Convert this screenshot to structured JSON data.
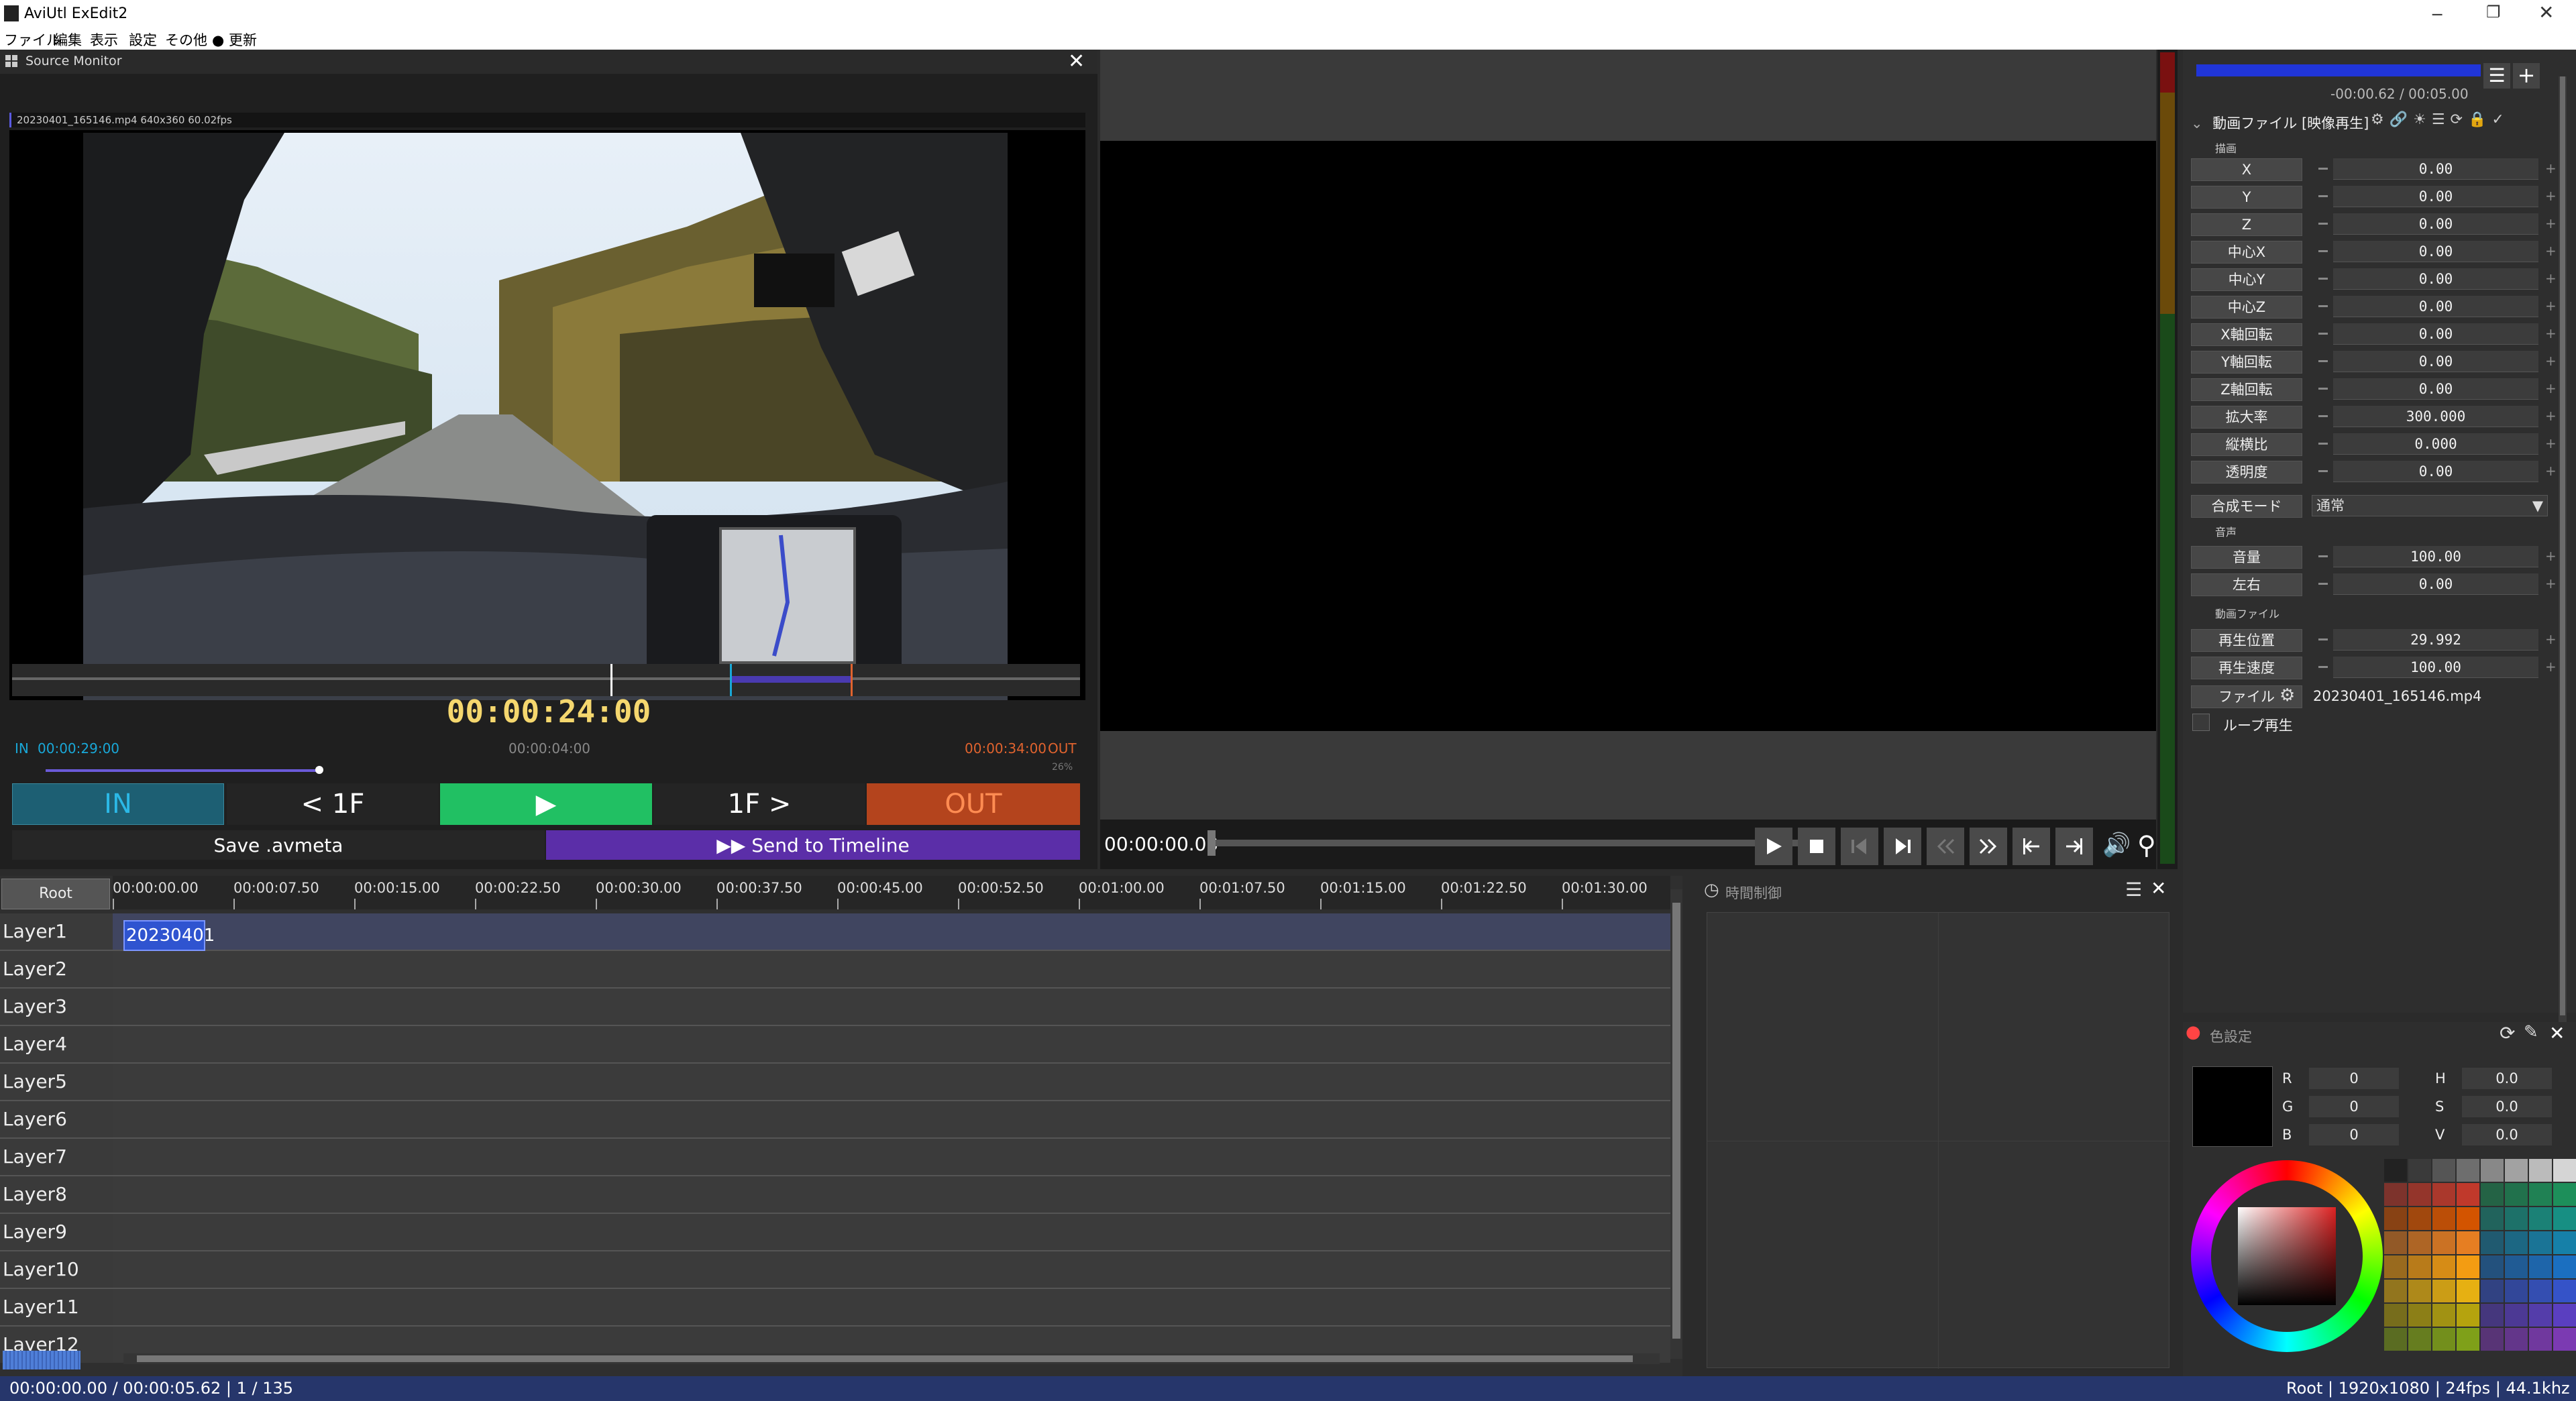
{
  "window": {
    "title": "AviUtl ExEdit2"
  },
  "menu": [
    "ファイル",
    "編集",
    "表示",
    "設定",
    "その他",
    "● 更新"
  ],
  "source_monitor": {
    "title": "Source Monitor",
    "file_info": "20230401_165146.mp4  640x360  60.02fps",
    "timecode": "00:00:24:00",
    "in_label": "IN",
    "in_time": "00:00:29:00",
    "duration": "00:00:04:00",
    "out_time": "00:00:34:00",
    "out_label": "OUT",
    "zoom_percent": "26%",
    "buttons": {
      "in": "IN",
      "prev": "< 1F",
      "play": "▶",
      "next": "1F >",
      "out": "OUT",
      "save": "Save .avmeta",
      "send": "▶▶  Send to Timeline"
    },
    "colors": {
      "in_btn": "#1d5f73",
      "play_btn": "#21c063",
      "out_btn": "#b4441d",
      "send_btn": "#5b2ea8",
      "timecode": "#f5d76e"
    }
  },
  "preview": {
    "timecode": "00:00:00.00"
  },
  "properties": {
    "time_display": "-00:00.62 / 00:05.00",
    "object_title": "動画ファイル [映像再生]",
    "section_draw": "描画",
    "rows": [
      {
        "label": "X",
        "value": "0.00"
      },
      {
        "label": "Y",
        "value": "0.00"
      },
      {
        "label": "Z",
        "value": "0.00"
      },
      {
        "label": "中心X",
        "value": "0.00"
      },
      {
        "label": "中心Y",
        "value": "0.00"
      },
      {
        "label": "中心Z",
        "value": "0.00"
      },
      {
        "label": "X軸回転",
        "value": "0.00"
      },
      {
        "label": "Y軸回転",
        "value": "0.00"
      },
      {
        "label": "Z軸回転",
        "value": "0.00"
      },
      {
        "label": "拡大率",
        "value": "300.000"
      },
      {
        "label": "縦横比",
        "value": "0.000"
      },
      {
        "label": "透明度",
        "value": "0.00"
      }
    ],
    "blend_label": "合成モード",
    "blend_value": "通常",
    "section_audio": "音声",
    "audio_rows": [
      {
        "label": "音量",
        "value": "100.00"
      },
      {
        "label": "左右",
        "value": "0.00"
      }
    ],
    "section_video": "動画ファイル",
    "video_rows": [
      {
        "label": "再生位置",
        "value": "29.992"
      },
      {
        "label": "再生速度",
        "value": "100.00"
      }
    ],
    "file_label": "ファイル",
    "file_value": "20230401_165146.mp4",
    "loop_label": "ループ再生"
  },
  "timeline": {
    "root_label": "Root",
    "ruler": [
      "00:00:00.00",
      "00:00:07.50",
      "00:00:15.00",
      "00:00:22.50",
      "00:00:30.00",
      "00:00:37.50",
      "00:00:45.00",
      "00:00:52.50",
      "00:01:00.00",
      "00:01:07.50",
      "00:01:15.00",
      "00:01:22.50",
      "00:01:30.00"
    ],
    "layers": [
      "Layer1",
      "Layer2",
      "Layer3",
      "Layer4",
      "Layer5",
      "Layer6",
      "Layer7",
      "Layer8",
      "Layer9",
      "Layer10",
      "Layer11",
      "Layer12"
    ],
    "clip_label": "20230401"
  },
  "time_control": {
    "title": "時間制御"
  },
  "color_settings": {
    "title": "色設定",
    "rgb": [
      {
        "label": "R",
        "value": "0"
      },
      {
        "label": "G",
        "value": "0"
      },
      {
        "label": "B",
        "value": "0"
      }
    ],
    "hsv": [
      {
        "label": "H",
        "value": "0.0"
      },
      {
        "label": "S",
        "value": "0.0"
      },
      {
        "label": "V",
        "value": "0.0"
      }
    ]
  },
  "status": {
    "left": "00:00:00.00 / 00:00:05.62  |  1 / 135",
    "right": "Root  |  1920x1080  |  24fps  |  44.1khz"
  }
}
